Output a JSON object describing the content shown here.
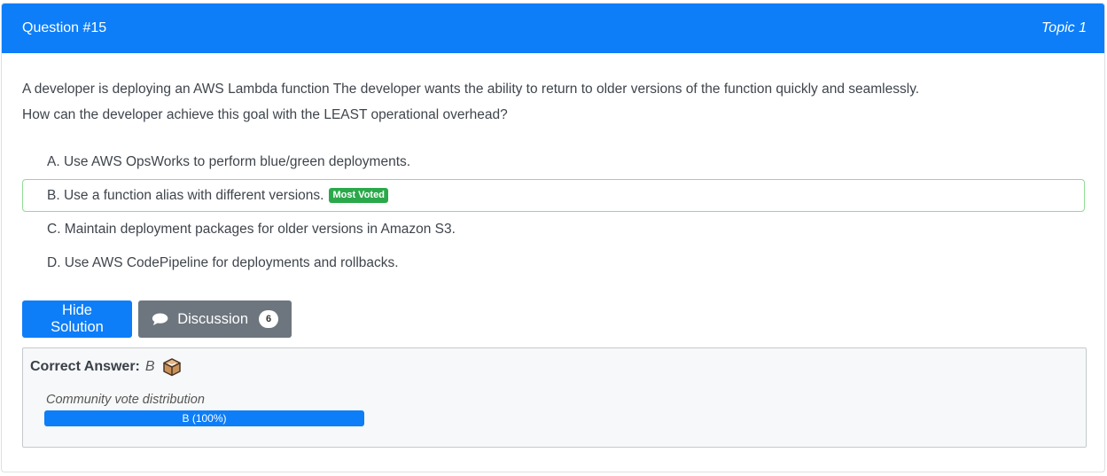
{
  "header": {
    "question_number": "Question #15",
    "topic": "Topic 1"
  },
  "question": {
    "line1": "A developer is deploying an AWS Lambda function The developer wants the ability to return to older versions of the function quickly and seamlessly.",
    "line2": "How can the developer achieve this goal with the LEAST operational overhead?"
  },
  "choices": [
    {
      "label": "A. Use AWS OpsWorks to perform blue/green deployments."
    },
    {
      "label": "B. Use a function alias with different versions.",
      "badge": "Most Voted"
    },
    {
      "label": "C. Maintain deployment packages for older versions in Amazon S3."
    },
    {
      "label": "D. Use AWS CodePipeline for deployments and rollbacks."
    }
  ],
  "buttons": {
    "hide_solution": "Hide Solution",
    "discussion": "Discussion",
    "discussion_count": "6"
  },
  "answer": {
    "label": "Correct Answer:",
    "value": "B",
    "vote_title": "Community vote distribution",
    "vote_bar_label": "B (100%)",
    "vote_fraction": 1.0
  },
  "colors": {
    "primary": "#0d7ef8",
    "secondary": "#6d767e",
    "most_voted": "#2ba94a"
  },
  "icons": {
    "discussion": "chat-bubble-icon",
    "answer": "box-icon"
  }
}
